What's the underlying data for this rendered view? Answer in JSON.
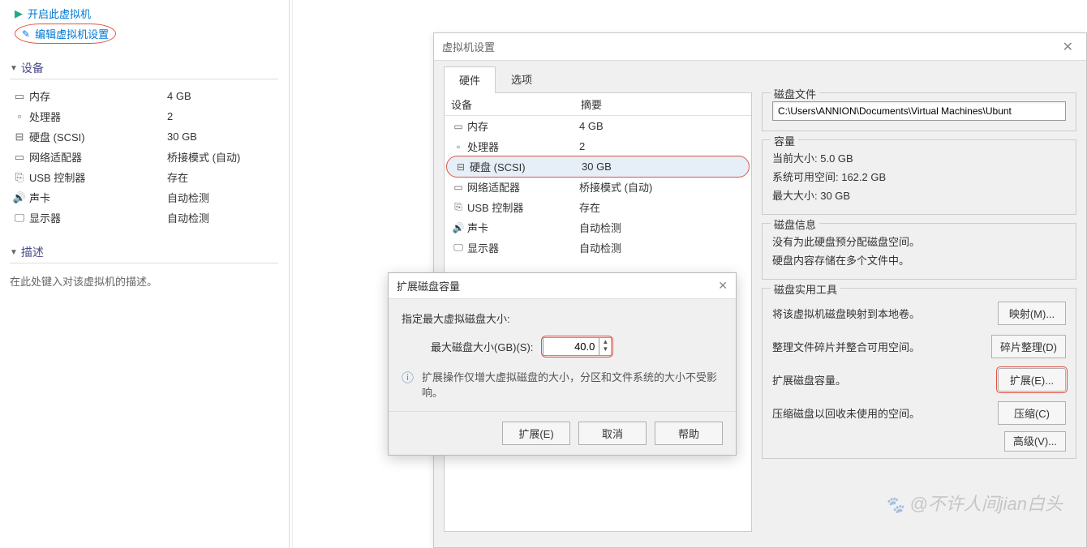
{
  "left": {
    "start_vm": "开启此虚拟机",
    "edit_settings": "编辑虚拟机设置",
    "section_devices": "设备",
    "devices": [
      {
        "icon": "▭",
        "label": "内存",
        "value": "4 GB"
      },
      {
        "icon": "▫",
        "label": "处理器",
        "value": "2"
      },
      {
        "icon": "⊟",
        "label": "硬盘 (SCSI)",
        "value": "30 GB"
      },
      {
        "icon": "▭",
        "label": "网络适配器",
        "value": "桥接模式 (自动)"
      },
      {
        "icon": "⎘",
        "label": "USB 控制器",
        "value": "存在"
      },
      {
        "icon": "🔊",
        "label": "声卡",
        "value": "自动检测"
      },
      {
        "icon": "🖵",
        "label": "显示器",
        "value": "自动检测"
      }
    ],
    "section_desc": "描述",
    "desc_placeholder": "在此处键入对该虚拟机的描述。"
  },
  "settings": {
    "title": "虚拟机设置",
    "tabs": {
      "hardware": "硬件",
      "options": "选项"
    },
    "hw_col_device": "设备",
    "hw_col_summary": "摘要",
    "hw_rows": [
      {
        "icon": "▭",
        "label": "内存",
        "summary": "4 GB",
        "sel": false
      },
      {
        "icon": "▫",
        "label": "处理器",
        "summary": "2",
        "sel": false
      },
      {
        "icon": "⊟",
        "label": "硬盘 (SCSI)",
        "summary": "30 GB",
        "sel": true
      },
      {
        "icon": "▭",
        "label": "网络适配器",
        "summary": "桥接模式 (自动)",
        "sel": false
      },
      {
        "icon": "⎘",
        "label": "USB 控制器",
        "summary": "存在",
        "sel": false
      },
      {
        "icon": "🔊",
        "label": "声卡",
        "summary": "自动检测",
        "sel": false
      },
      {
        "icon": "🖵",
        "label": "显示器",
        "summary": "自动检测",
        "sel": false
      }
    ],
    "disk_file_legend": "磁盘文件",
    "disk_file_path": "C:\\Users\\ANNION\\Documents\\Virtual Machines\\Ubunt",
    "capacity_legend": "容量",
    "cap_current": "当前大小: 5.0 GB",
    "cap_free": "系统可用空间: 162.2 GB",
    "cap_max": "最大大小: 30 GB",
    "info_legend": "磁盘信息",
    "info_line1": "没有为此硬盘预分配磁盘空间。",
    "info_line2": "硬盘内容存储在多个文件中。",
    "tools_legend": "磁盘实用工具",
    "tool_map_txt": "将该虚拟机磁盘映射到本地卷。",
    "tool_map_btn": "映射(M)...",
    "tool_defrag_txt": "整理文件碎片并整合可用空间。",
    "tool_defrag_btn": "碎片整理(D)",
    "tool_expand_txt": "扩展磁盘容量。",
    "tool_expand_btn": "扩展(E)...",
    "tool_compact_txt": "压缩磁盘以回收未使用的空间。",
    "tool_compact_btn": "压缩(C)",
    "advanced_btn": "高级(V)..."
  },
  "expand": {
    "title": "扩展磁盘容量",
    "specify": "指定最大虚拟磁盘大小:",
    "max_label": "最大磁盘大小(GB)(S):",
    "value": "40.0",
    "note": "扩展操作仅增大虚拟磁盘的大小，分区和文件系统的大小不受影响。",
    "btn_expand": "扩展(E)",
    "btn_cancel": "取消",
    "btn_help": "帮助"
  },
  "watermark": "@不许人间jian白头"
}
